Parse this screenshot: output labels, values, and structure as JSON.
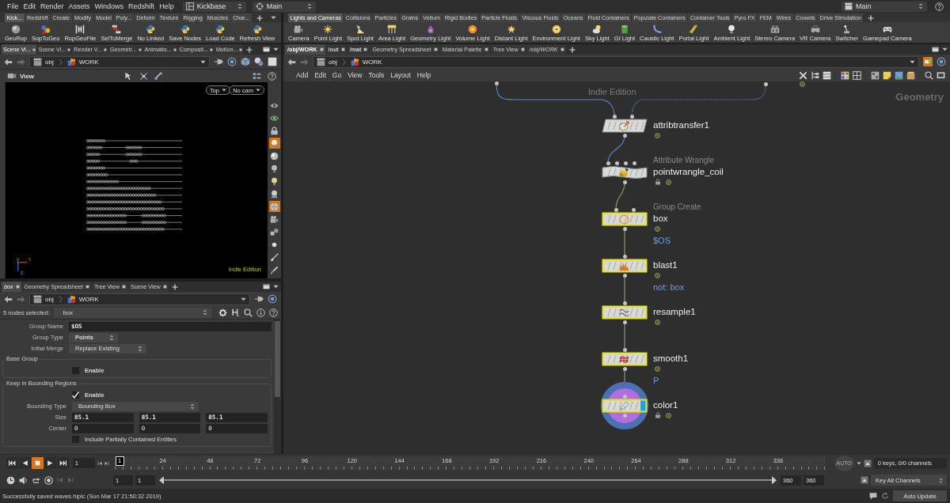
{
  "menu_bar": {
    "items": [
      "File",
      "Edit",
      "Render",
      "Assets",
      "Windows",
      "Redshift",
      "Help"
    ],
    "desktop": "Kickbase",
    "context": "Main",
    "right_context": "Main"
  },
  "shelf_left": {
    "tabs": [
      {
        "label": "Kick...",
        "selected": true
      },
      {
        "label": "Redshift",
        "selected": false
      },
      {
        "label": "Create",
        "selected": false
      },
      {
        "label": "Modify",
        "selected": false
      },
      {
        "label": "Model",
        "selected": false
      },
      {
        "label": "Poly...",
        "selected": false
      },
      {
        "label": "Deform",
        "selected": false
      },
      {
        "label": "Texture",
        "selected": false
      },
      {
        "label": "Rigging",
        "selected": false
      },
      {
        "label": "Muscles",
        "selected": false
      },
      {
        "label": "Char...",
        "selected": false
      }
    ],
    "tools": [
      {
        "label": "GeoRop",
        "kind": "sphere"
      },
      {
        "label": "SopToGeo",
        "kind": "shapes"
      },
      {
        "label": "RopGeoFile",
        "kind": "hbox"
      },
      {
        "label": "SelToMerge",
        "kind": "nodes"
      },
      {
        "label": "No Linked",
        "kind": "python"
      },
      {
        "label": "Save Nodes",
        "kind": "python"
      },
      {
        "label": "Load Code",
        "kind": "python"
      },
      {
        "label": "Refresh View",
        "kind": "python"
      }
    ]
  },
  "shelf_right": {
    "tabs": [
      {
        "label": "Lights and Cameras",
        "selected": true
      },
      {
        "label": "Collisions",
        "selected": false
      },
      {
        "label": "Particles",
        "selected": false
      },
      {
        "label": "Grains",
        "selected": false
      },
      {
        "label": "Vellum",
        "selected": false
      },
      {
        "label": "Rigid Bodies",
        "selected": false
      },
      {
        "label": "Particle Fluids",
        "selected": false
      },
      {
        "label": "Viscous Fluids",
        "selected": false
      },
      {
        "label": "Oceans",
        "selected": false
      },
      {
        "label": "Fluid Containers",
        "selected": false
      },
      {
        "label": "Populate Containers",
        "selected": false
      },
      {
        "label": "Container Tools",
        "selected": false
      },
      {
        "label": "Pyro FX",
        "selected": false
      },
      {
        "label": "FEM",
        "selected": false
      },
      {
        "label": "Wires",
        "selected": false
      },
      {
        "label": "Crowds",
        "selected": false
      },
      {
        "label": "Drive Simulation",
        "selected": false
      }
    ],
    "tools": [
      {
        "label": "Camera",
        "kind": "camera"
      },
      {
        "label": "Point Light",
        "kind": "sun"
      },
      {
        "label": "Spot Light",
        "kind": "spot"
      },
      {
        "label": "Area Light",
        "kind": "area"
      },
      {
        "label": "Geometry Light",
        "kind": "geolight"
      },
      {
        "label": "Volume Light",
        "kind": "volume"
      },
      {
        "label": "Distant Light",
        "kind": "distant"
      },
      {
        "label": "Environment Light",
        "kind": "environment"
      },
      {
        "label": "Sky Light",
        "kind": "sky"
      },
      {
        "label": "GI Light",
        "kind": "gi"
      },
      {
        "label": "Caustic Light",
        "kind": "caustic"
      },
      {
        "label": "Portal Light",
        "kind": "portal"
      },
      {
        "label": "Ambient Light",
        "kind": "ambient"
      },
      {
        "label": "Stereo Camera",
        "kind": "stereo"
      },
      {
        "label": "VR Camera",
        "kind": "vr"
      },
      {
        "label": "Switcher",
        "kind": "switcher"
      },
      {
        "label": "Gamepad Camera",
        "kind": "gamepad"
      }
    ]
  },
  "scene_pane": {
    "tabs": [
      {
        "label": "Scene Vi...",
        "selected": true
      },
      {
        "label": "Scene Vi...",
        "selected": false
      },
      {
        "label": "Render V...",
        "selected": false
      },
      {
        "label": "Geometr...",
        "selected": false
      },
      {
        "label": "Animatio...",
        "selected": false
      },
      {
        "label": "Composit...",
        "selected": false
      },
      {
        "label": "Motion...",
        "selected": false
      }
    ],
    "path": [
      {
        "label": "obj",
        "kind": "context"
      },
      {
        "label": "WORK",
        "kind": "geometry"
      }
    ],
    "viewer": {
      "title": "View",
      "view_menu": "Top",
      "camera_menu": "No cam",
      "axis_labels": [
        "y",
        "x",
        "z"
      ],
      "watermark": "Indie Edition",
      "display_tools": [
        {
          "kind": "ghost",
          "on": false
        },
        {
          "kind": "template",
          "on": false
        },
        {
          "kind": "lock",
          "on": false
        },
        {
          "kind": "light",
          "on": true
        },
        {
          "kind": "shading",
          "on": false
        },
        {
          "kind": "bulb",
          "on": false
        },
        {
          "kind": "bulbalt",
          "on": false
        },
        {
          "kind": "headlight",
          "on": false
        },
        {
          "kind": "background",
          "on": true
        },
        {
          "kind": "camera",
          "on": false
        },
        {
          "kind": "instance",
          "on": false
        },
        {
          "kind": "point",
          "on": false
        },
        {
          "kind": "brush",
          "on": false
        },
        {
          "kind": "pipette",
          "on": false
        }
      ]
    }
  },
  "parameter_pane": {
    "tabs": [
      {
        "label": "box",
        "selected": true,
        "linked": true
      },
      {
        "label": "Geometry Spreadsheet",
        "selected": false,
        "linked": false
      },
      {
        "label": "Tree View",
        "selected": false,
        "linked": false
      },
      {
        "label": "Scene View",
        "selected": false,
        "linked": false
      }
    ],
    "path": [
      {
        "label": "obj",
        "kind": "context"
      },
      {
        "label": "WORK",
        "kind": "geometry"
      }
    ],
    "selection_label": "5 nodes selected:",
    "node_name": "box",
    "parameters": [
      {
        "kind": "text",
        "label": "Group Name",
        "value": "$OS",
        "changed": true
      },
      {
        "kind": "menu",
        "label": "Group Type",
        "value": "Points",
        "changed": true
      },
      {
        "kind": "menu",
        "label": "Initial Merge",
        "value": "Replace Existing",
        "changed": false
      }
    ],
    "sections": [
      {
        "title": "Base Group",
        "parameters": [
          {
            "kind": "toggle",
            "label": "Enable",
            "checked": false,
            "changed": true
          }
        ]
      },
      {
        "title": "Keep in Bounding Regions",
        "parameters": [
          {
            "kind": "toggle",
            "label": "Enable",
            "checked": true,
            "changed": true
          },
          {
            "kind": "menu",
            "label": "Bounding Type",
            "value": "Bounding Box",
            "changed": false
          },
          {
            "kind": "vector",
            "label": "Size",
            "values": [
              "85.1",
              "85.1",
              "85.1"
            ],
            "changed": true
          },
          {
            "kind": "vector",
            "label": "Center",
            "values": [
              "0",
              "0",
              "0"
            ],
            "changed": false
          },
          {
            "kind": "toggle",
            "label": "Include Partially Contained Entities",
            "checked": false,
            "changed": false
          }
        ]
      }
    ]
  },
  "network_pane": {
    "tabs": [
      {
        "label": "/obj/WORK",
        "kind": "network",
        "selected": true,
        "linked": false
      },
      {
        "label": "/out",
        "kind": "network",
        "selected": false,
        "linked": false
      },
      {
        "label": "/mat",
        "kind": "network",
        "selected": false,
        "linked": false
      },
      {
        "label": "Geometry Spreadsheet",
        "kind": "panel",
        "selected": false,
        "linked": false
      },
      {
        "label": "Material Palette",
        "kind": "panel",
        "selected": false,
        "linked": false
      },
      {
        "label": "Tree View",
        "kind": "panel",
        "selected": false,
        "linked": false
      },
      {
        "label": "/obj/WORK",
        "kind": "network",
        "selected": false,
        "linked": true
      }
    ],
    "path": [
      {
        "label": "obj",
        "kind": "context"
      },
      {
        "label": "WORK",
        "kind": "geometry"
      }
    ],
    "menu": [
      "Add",
      "Edit",
      "Go",
      "View",
      "Tools",
      "Layout",
      "Help"
    ],
    "watermark": "Indie Edition",
    "context_label": "Geometry",
    "nodes": [
      {
        "name": "attribtransfer1",
        "kind": "attribtransfer",
        "selected": false,
        "locked": false,
        "current": false,
        "display": false
      },
      {
        "name": "pointwrangle_coil",
        "type_label": "Attribute Wrangle",
        "kind": "attribwrangle",
        "selected": false,
        "locked": true,
        "current": false,
        "display": false
      },
      {
        "name": "box",
        "type_label": "Group Create",
        "kind": "groupcreate",
        "note": "$OS",
        "selected": true,
        "locked": false,
        "current": false,
        "display": false
      },
      {
        "name": "blast1",
        "kind": "blast",
        "note": "not: box",
        "selected": true,
        "locked": false,
        "current": false,
        "display": false
      },
      {
        "name": "resample1",
        "kind": "resample",
        "selected": true,
        "locked": false,
        "current": false,
        "display": false
      },
      {
        "name": "smooth1",
        "kind": "smooth",
        "note": "P",
        "selected": true,
        "locked": false,
        "current": false,
        "display": false
      },
      {
        "name": "color1",
        "kind": "color",
        "selected": true,
        "locked": true,
        "current": true,
        "display": true
      }
    ]
  },
  "timeline": {
    "controls": [
      {
        "kind": "start",
        "selected": false
      },
      {
        "kind": "reverse",
        "selected": false
      },
      {
        "kind": "stop",
        "selected": true
      },
      {
        "kind": "play",
        "selected": false
      },
      {
        "kind": "end",
        "selected": false
      }
    ],
    "frame": "1",
    "current_frame": "1",
    "ticks": [
      "24",
      "48",
      "72",
      "96",
      "120",
      "144",
      "168",
      "192",
      "216",
      "240",
      "264",
      "288",
      "312",
      "336"
    ],
    "start": "1",
    "range_start": "1",
    "range_slider": {
      "level": 1
    },
    "range_end": "360",
    "end": "360",
    "auto_key": "AUTO",
    "keys": "0 keys, 0/0 channels",
    "key_mode": "Key All Channels"
  },
  "status_bar": {
    "message": "Successfully saved waves.hiplc (Sun Mar 17 21:50:32 2019)",
    "update_mode": "Auto Update"
  }
}
